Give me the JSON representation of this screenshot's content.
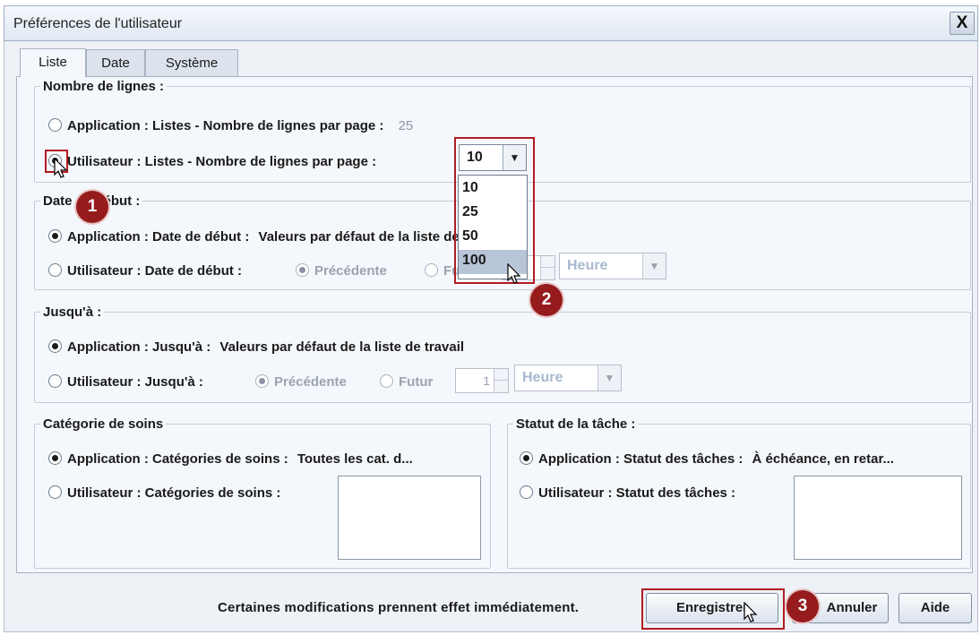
{
  "window": {
    "title": "Préférences de l'utilisateur",
    "close_label": "X"
  },
  "tabs": [
    {
      "label": "Liste",
      "active": true
    },
    {
      "label": "Date",
      "active": false
    },
    {
      "label": "Système",
      "active": false
    }
  ],
  "nombre_lignes": {
    "legend": "Nombre de lignes :",
    "app_label": "Application : Listes - Nombre de lignes par page :",
    "app_value": "25",
    "user_label": "Utilisateur : Listes - Nombre de lignes par page :",
    "selected_value": "10",
    "options": [
      "10",
      "25",
      "50",
      "100"
    ],
    "hovered_option": "100"
  },
  "date_debut": {
    "legend": "Date de début :",
    "app_label": "Application : Date de début :",
    "app_value": "Valeurs par défaut de la liste de travail",
    "user_label": "Utilisateur : Date de début :",
    "prev_label": "Précédente",
    "future_label": "Futur",
    "unit_value": "Heure"
  },
  "jusqua": {
    "legend": "Jusqu'à :",
    "app_label": "Application : Jusqu'à :",
    "app_value": "Valeurs par défaut de la liste de travail",
    "user_label": "Utilisateur : Jusqu'à :",
    "prev_label": "Précédente",
    "future_label": "Futur",
    "spinner_value": "1",
    "unit_value": "Heure"
  },
  "categorie": {
    "legend": "Catégorie de soins",
    "app_label": "Application : Catégories de soins :",
    "app_value": "Toutes les cat. d...",
    "user_label": "Utilisateur : Catégories de soins :"
  },
  "statut": {
    "legend": "Statut de la tâche :",
    "app_label": "Application : Statut des tâches :",
    "app_value": "À échéance, en retar...",
    "user_label": "Utilisateur : Statut des tâches :"
  },
  "footer": {
    "note": "Certaines modifications prennent effet immédiatement.",
    "save_label": "Enregistrer",
    "cancel_label": "Annuler",
    "help_label": "Aide"
  },
  "annotations": {
    "step1": "1",
    "step2": "2",
    "step3": "3",
    "color": "#951b1d"
  }
}
